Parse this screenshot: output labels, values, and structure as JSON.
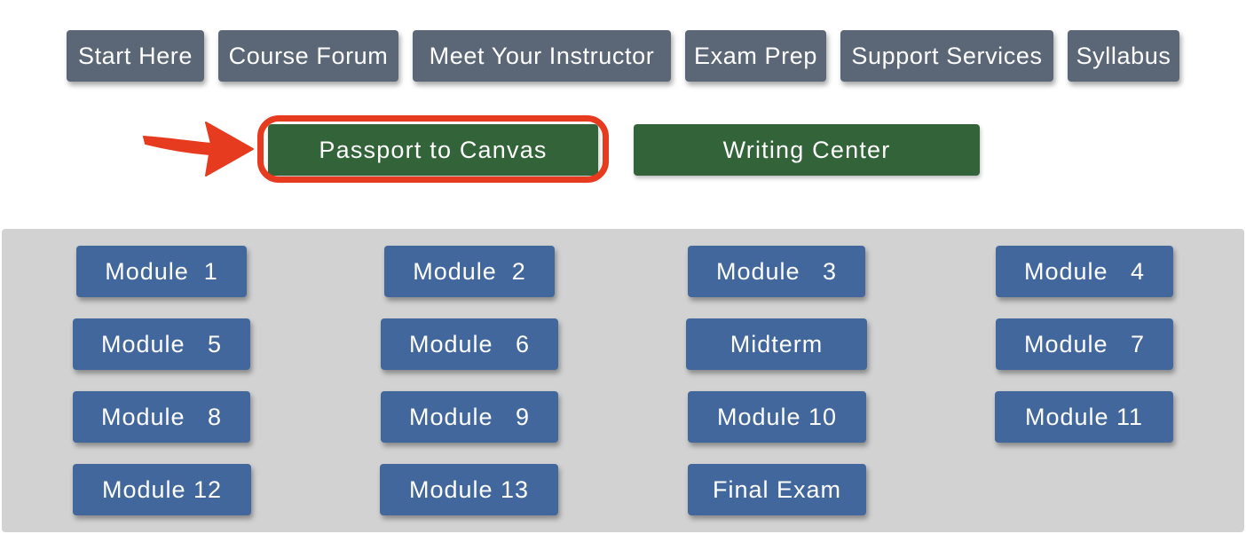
{
  "top_nav": {
    "start_here": "Start Here",
    "course_forum": "Course Forum",
    "meet_instructor": "Meet Your Instructor",
    "exam_prep": "Exam Prep",
    "support_services": "Support Services",
    "syllabus": "Syllabus"
  },
  "resources": {
    "passport": "Passport to Canvas",
    "writing_center": "Writing Center"
  },
  "modules": {
    "m1": "Module  1",
    "m2": "Module  2",
    "m3": "Module   3",
    "m4": "Module   4",
    "m5": "Module   5",
    "m6": "Module   6",
    "midterm": "Midterm",
    "m7": "Module   7",
    "m8": "Module   8",
    "m9": "Module   9",
    "m10": "Module 10",
    "m11": "Module 11",
    "m12": "Module 12",
    "m13": "Module 13",
    "final": "Final Exam"
  },
  "colors": {
    "nav_button": "#5b6676",
    "green_button": "#326339",
    "module_button": "#42679c",
    "panel": "#d2d2d2",
    "highlight": "#e63b1f"
  }
}
